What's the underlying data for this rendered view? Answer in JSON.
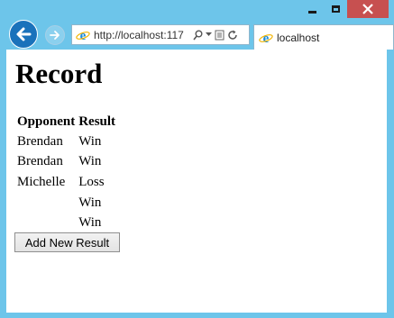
{
  "browser": {
    "address_url": "http://localhost:117",
    "tab_title": "localhost"
  },
  "page": {
    "title": "Record",
    "table": {
      "headers": [
        "Opponent",
        "Result"
      ],
      "rows": [
        {
          "opponent": "Brendan",
          "result": "Win"
        },
        {
          "opponent": "Brendan",
          "result": "Win"
        },
        {
          "opponent": "Michelle",
          "result": "Loss"
        },
        {
          "opponent": "",
          "result": "Win"
        },
        {
          "opponent": "",
          "result": "Win"
        }
      ]
    },
    "add_button_label": "Add New Result"
  },
  "icons": {
    "back": "back-arrow-icon",
    "forward": "forward-arrow-icon",
    "ie": "ie-logo-icon",
    "search": "search-icon",
    "dropdown": "chevron-down-icon",
    "compat": "compatibility-view-icon",
    "refresh": "refresh-icon"
  },
  "colors": {
    "frame": "#6dc5ea",
    "close_button": "#c75050",
    "back_button": "#1a72bb"
  }
}
